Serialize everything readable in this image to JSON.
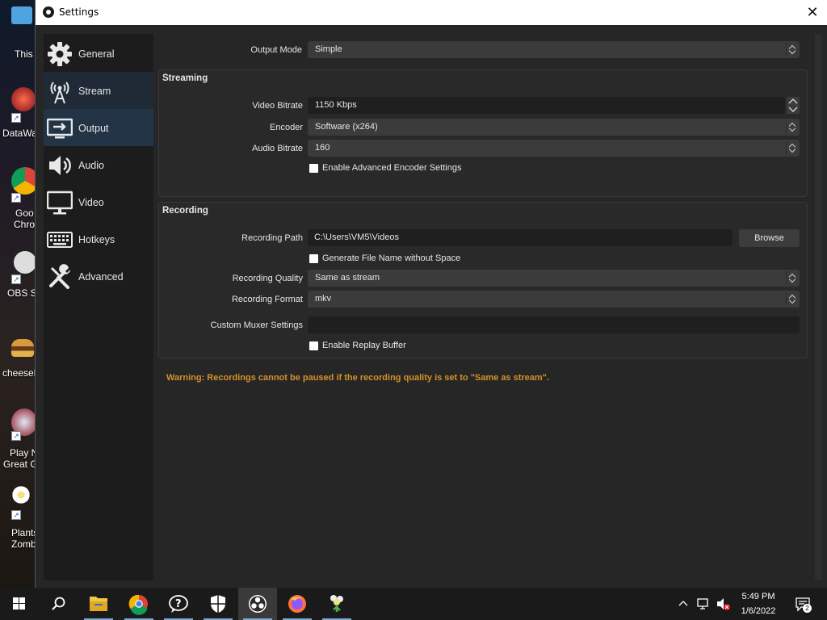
{
  "desktop": {
    "icons": [
      {
        "label": "This"
      },
      {
        "label": "DataWa"
      },
      {
        "label": "Goo",
        "label2": "Chro"
      },
      {
        "label": "OBS St"
      },
      {
        "label": "cheeseb"
      },
      {
        "label": "Play N",
        "label2": "Great G"
      },
      {
        "label": "Plants",
        "label2": "Zomb"
      }
    ]
  },
  "window": {
    "title": "Settings",
    "close_glyph": "✕"
  },
  "sidebar": {
    "items": [
      {
        "label": "General",
        "icon": "gear-icon",
        "active": false
      },
      {
        "label": "Stream",
        "icon": "antenna-icon",
        "active": false
      },
      {
        "label": "Output",
        "icon": "output-icon",
        "active": true
      },
      {
        "label": "Audio",
        "icon": "speaker-icon",
        "active": false
      },
      {
        "label": "Video",
        "icon": "monitor-icon",
        "active": false
      },
      {
        "label": "Hotkeys",
        "icon": "keyboard-icon",
        "active": false
      },
      {
        "label": "Advanced",
        "icon": "tools-icon",
        "active": false
      }
    ]
  },
  "output": {
    "mode_label": "Output Mode",
    "mode_value": "Simple",
    "streaming": {
      "title": "Streaming",
      "video_bitrate_label": "Video Bitrate",
      "video_bitrate_value": "1150 Kbps",
      "encoder_label": "Encoder",
      "encoder_value": "Software (x264)",
      "audio_bitrate_label": "Audio Bitrate",
      "audio_bitrate_value": "160",
      "advanced_encoder_label": "Enable Advanced Encoder Settings",
      "advanced_encoder_checked": false
    },
    "recording": {
      "title": "Recording",
      "path_label": "Recording Path",
      "path_value": "C:\\Users\\VM5\\Videos",
      "browse_label": "Browse",
      "no_space_label": "Generate File Name without Space",
      "no_space_checked": false,
      "quality_label": "Recording Quality",
      "quality_value": "Same as stream",
      "format_label": "Recording Format",
      "format_value": "mkv",
      "muxer_label": "Custom Muxer Settings",
      "muxer_value": "",
      "replay_label": "Enable Replay Buffer",
      "replay_checked": false
    },
    "warning": "Warning: Recordings cannot be paused if the recording quality is set to \"Same as stream\"."
  },
  "taskbar": {
    "apps": [
      {
        "name": "start-button"
      },
      {
        "name": "search-button"
      },
      {
        "name": "file-explorer"
      },
      {
        "name": "chrome"
      },
      {
        "name": "help"
      },
      {
        "name": "security"
      },
      {
        "name": "obs",
        "active": true
      },
      {
        "name": "firefox"
      },
      {
        "name": "plants-vs-zombies"
      }
    ],
    "time": "5:49 PM",
    "date": "1/6/2022",
    "notification_count": "2"
  },
  "colors": {
    "accent_active": "#243447",
    "warning": "#d4912a",
    "window_bg": "#262626"
  }
}
